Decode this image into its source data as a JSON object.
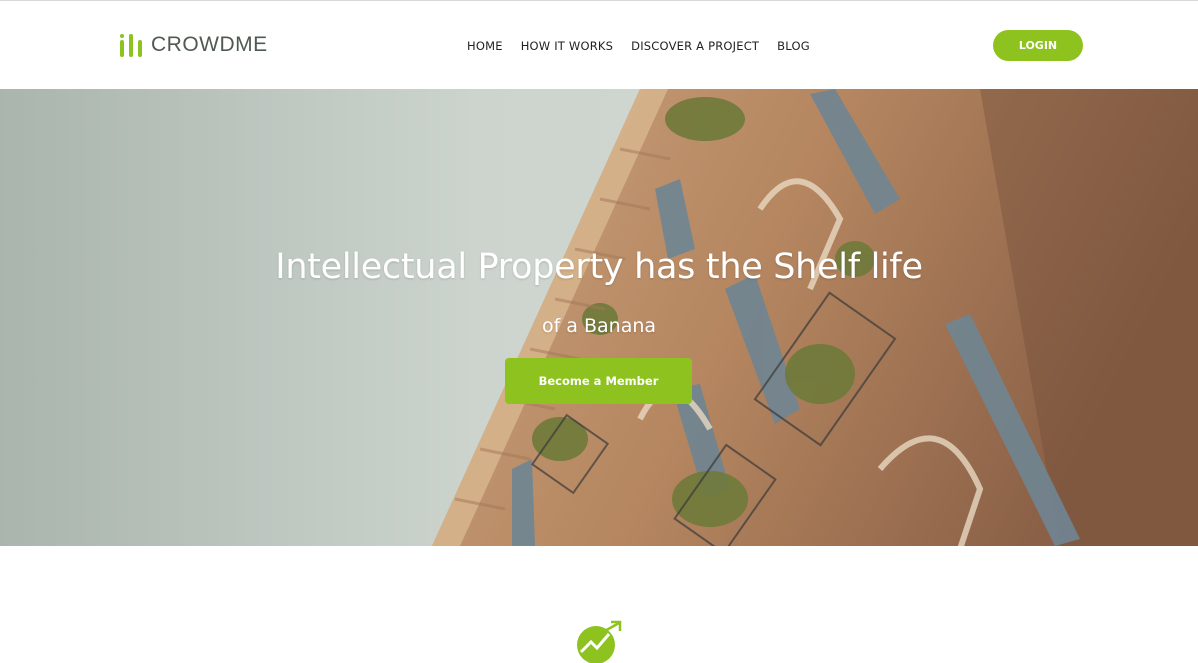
{
  "brand": {
    "name": "CROWDME",
    "icon": "bar-chart-logo-icon",
    "color": "#8dc21f"
  },
  "nav": {
    "items": [
      {
        "label": "HOME"
      },
      {
        "label": "HOW IT WORKS"
      },
      {
        "label": "DISCOVER A PROJECT"
      },
      {
        "label": "BLOG"
      }
    ],
    "login_label": "LOGIN"
  },
  "hero": {
    "title": "Intellectual Property has the Shelf life",
    "subtitle": "of a Banana",
    "cta_label": "Become a Member",
    "background": "building-facade-photo"
  },
  "feature": {
    "icon": "growth-arrow-icon"
  },
  "colors": {
    "accent": "#8dc21f",
    "text_dark": "#222222",
    "white": "#ffffff"
  }
}
